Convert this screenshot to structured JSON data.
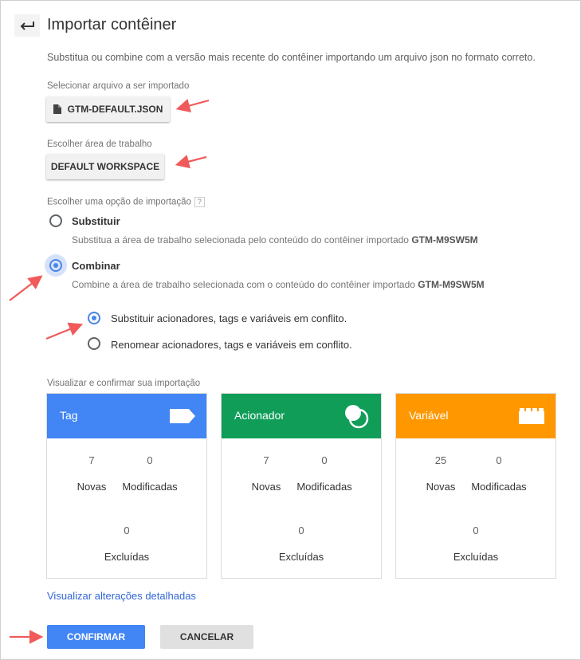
{
  "header": {
    "title": "Importar contêiner"
  },
  "description": "Substitua ou combine com a versão mais recente do contêiner importando um arquivo json no formato correto.",
  "file": {
    "label": "Selecionar arquivo a ser importado",
    "button": "GTM-DEFAULT.JSON"
  },
  "workspace": {
    "label": "Escolher área de trabalho",
    "button": "DEFAULT WORKSPACE"
  },
  "import_option": {
    "label": "Escolher uma opção de importação",
    "help": "?",
    "overwrite": {
      "title": "Substituir",
      "sub_text": "Substitua a área de trabalho selecionada pelo conteúdo do contêiner importado",
      "container": "GTM-M9SW5M"
    },
    "merge": {
      "title": "Combinar",
      "sub_text": "Combine a área de trabalho selecionada com o conteúdo do contêiner importado",
      "container": "GTM-M9SW5M",
      "selected": true
    },
    "conflict_overwrite": "Substituir acionadores, tags e variáveis em conflito.",
    "conflict_rename": "Renomear acionadores, tags e variáveis em conflito."
  },
  "preview": {
    "label": "Visualizar e confirmar sua importação",
    "cards": [
      {
        "title": "Tag",
        "color": "#4285f4",
        "icon": "tag-icon",
        "new": "7",
        "modified": "0",
        "deleted": "0"
      },
      {
        "title": "Acionador",
        "color": "#0f9d58",
        "icon": "trigger-icon",
        "new": "7",
        "modified": "0",
        "deleted": "0"
      },
      {
        "title": "Variável",
        "color": "#ff9800",
        "icon": "variable-icon",
        "new": "25",
        "modified": "0",
        "deleted": "0"
      }
    ],
    "new_label": "Novas",
    "modified_label": "Modificadas",
    "deleted_label": "Excluídas"
  },
  "details_link": "Visualizar alterações detalhadas",
  "actions": {
    "confirm": "CONFIRMAR",
    "cancel": "CANCELAR"
  },
  "accent": "#4a86e8"
}
